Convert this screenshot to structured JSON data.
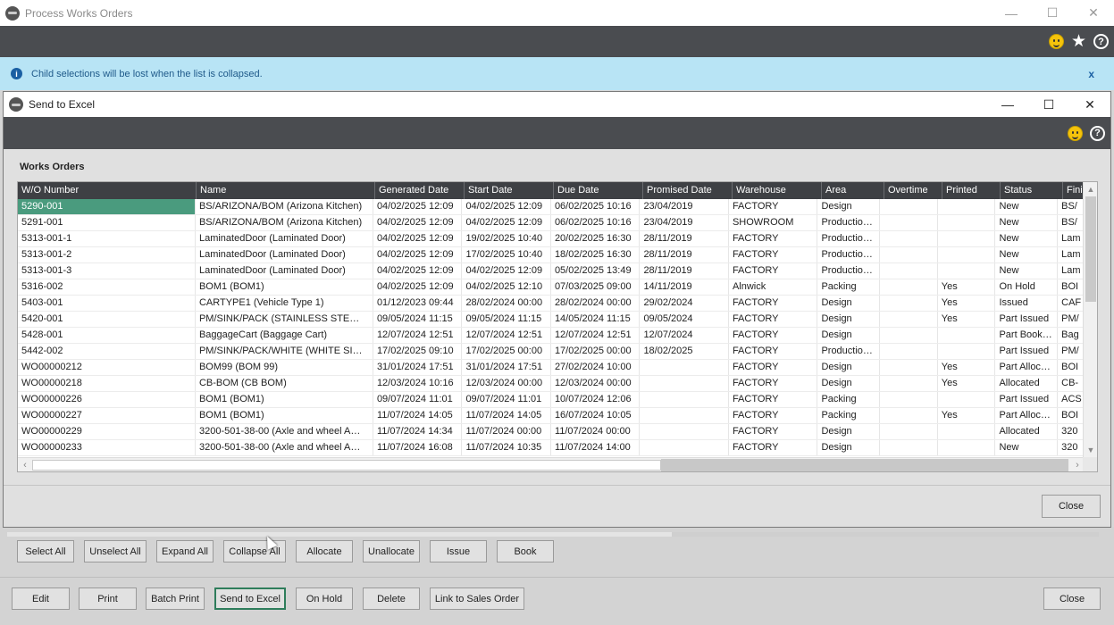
{
  "outer_window": {
    "title": "Process Works Orders",
    "controls": [
      "minimize",
      "maximize",
      "close"
    ]
  },
  "info_banner": {
    "text": "Child selections will be lost when the list is collapsed.",
    "close": "x"
  },
  "dialog": {
    "title": "Send to Excel",
    "section_title": "Works Orders",
    "close_label": "Close"
  },
  "grid": {
    "columns": [
      "W/O Number",
      "Name",
      "Generated Date",
      "Start Date",
      "Due Date",
      "Promised Date",
      "Warehouse",
      "Area",
      "Overtime",
      "Printed",
      "Status",
      "Finis"
    ],
    "rows": [
      [
        "5290-001",
        "BS/ARIZONA/BOM (Arizona Kitchen)",
        "04/02/2025 12:09",
        "04/02/2025 12:09",
        "06/02/2025 10:16",
        "23/04/2019",
        "FACTORY",
        "Design",
        "",
        "",
        "New",
        "BS/"
      ],
      [
        "5291-001",
        "BS/ARIZONA/BOM (Arizona Kitchen)",
        "04/02/2025 12:09",
        "04/02/2025 12:09",
        "06/02/2025 10:16",
        "23/04/2019",
        "SHOWROOM",
        "Productio…",
        "",
        "",
        "New",
        "BS/"
      ],
      [
        "5313-001-1",
        "LaminatedDoor (Laminated Door)",
        "04/02/2025 12:09",
        "19/02/2025 10:40",
        "20/02/2025 16:30",
        "28/11/2019",
        "FACTORY",
        "Productio…",
        "",
        "",
        "New",
        "Lam"
      ],
      [
        "5313-001-2",
        "LaminatedDoor (Laminated Door)",
        "04/02/2025 12:09",
        "17/02/2025 10:40",
        "18/02/2025 16:30",
        "28/11/2019",
        "FACTORY",
        "Productio…",
        "",
        "",
        "New",
        "Lam"
      ],
      [
        "5313-001-3",
        "LaminatedDoor (Laminated Door)",
        "04/02/2025 12:09",
        "04/02/2025 12:09",
        "05/02/2025 13:49",
        "28/11/2019",
        "FACTORY",
        "Productio…",
        "",
        "",
        "New",
        "Lam"
      ],
      [
        "5316-002",
        "BOM1 (BOM1)",
        "04/02/2025 12:09",
        "04/02/2025 12:10",
        "07/03/2025 09:00",
        "14/11/2019",
        "Alnwick",
        "Packing",
        "",
        "Yes",
        "On Hold",
        "BOI"
      ],
      [
        "5403-001",
        "CARTYPE1  (Vehicle Type 1)",
        "01/12/2023 09:44",
        "28/02/2024 00:00",
        "28/02/2024 00:00",
        "29/02/2024",
        "FACTORY",
        "Design",
        "",
        "Yes",
        "Issued",
        "CAF"
      ],
      [
        "5420-001",
        "PM/SINK/PACK    (STAINLESS STE…",
        "09/05/2024 11:15",
        "09/05/2024 11:15",
        "14/05/2024 11:15",
        "09/05/2024",
        "FACTORY",
        "Design",
        "",
        "Yes",
        "Part Issued",
        "PM/"
      ],
      [
        "5428-001",
        "BaggageCart  (Baggage Cart)",
        "12/07/2024 12:51",
        "12/07/2024 12:51",
        "12/07/2024 12:51",
        "12/07/2024",
        "FACTORY",
        "Design",
        "",
        "",
        "Part Book…",
        "Bag"
      ],
      [
        "5442-002",
        "PM/SINK/PACK/WHITE    (WHITE SI…",
        "17/02/2025 09:10",
        "17/02/2025 00:00",
        "17/02/2025 00:00",
        "18/02/2025",
        "FACTORY",
        "Productio…",
        "",
        "",
        "Part Issued",
        "PM/"
      ],
      [
        "WO00000212",
        "BOM99  (BOM 99)",
        "31/01/2024 17:51",
        "31/01/2024 17:51",
        "27/02/2024 10:00",
        "",
        "FACTORY",
        "Design",
        "",
        "Yes",
        "Part Alloc…",
        "BOI"
      ],
      [
        "WO00000218",
        "CB-BOM  (CB BOM)",
        "12/03/2024 10:16",
        "12/03/2024 00:00",
        "12/03/2024 00:00",
        "",
        "FACTORY",
        "Design",
        "",
        "Yes",
        "Allocated",
        "CB-"
      ],
      [
        "WO00000226",
        "BOM1  (BOM1)",
        "09/07/2024 11:01",
        "09/07/2024 11:01",
        "10/07/2024 12:06",
        "",
        "FACTORY",
        "Packing",
        "",
        "",
        "Part Issued",
        "ACS"
      ],
      [
        "WO00000227",
        "BOM1  (BOM1)",
        "11/07/2024 14:05",
        "11/07/2024 14:05",
        "16/07/2024 10:05",
        "",
        "FACTORY",
        "Packing",
        "",
        "Yes",
        "Part Alloc…",
        "BOI"
      ],
      [
        "WO00000229",
        "3200-501-38-00  (Axle and wheel A…",
        "11/07/2024 14:34",
        "11/07/2024 00:00",
        "11/07/2024 00:00",
        "",
        "FACTORY",
        "Design",
        "",
        "",
        "Allocated",
        "320"
      ],
      [
        "WO00000233",
        "3200-501-38-00  (Axle and wheel A…",
        "11/07/2024 16:08",
        "11/07/2024 10:35",
        "11/07/2024 14:00",
        "",
        "FACTORY",
        "Design",
        "",
        "",
        "New",
        "320"
      ]
    ]
  },
  "action_row_1": [
    "Select All",
    "Unselect All",
    "Expand All",
    "Collapse All",
    "Allocate",
    "Unallocate",
    "Issue",
    "Book"
  ],
  "action_row_2": [
    "Edit",
    "Print",
    "Batch Print",
    "Send to Excel",
    "On Hold",
    "Delete",
    "Link to Sales Order"
  ],
  "outer_close_label": "Close",
  "icons": {
    "feedback": "smiley-icon",
    "favourite": "star-icon",
    "help": "help-icon",
    "info": "info-icon"
  },
  "colors": {
    "toolbar": "#4a4c50",
    "banner": "#b8e4f5",
    "selection": "#4a9b7e",
    "focus_border": "#2e7d5b"
  }
}
